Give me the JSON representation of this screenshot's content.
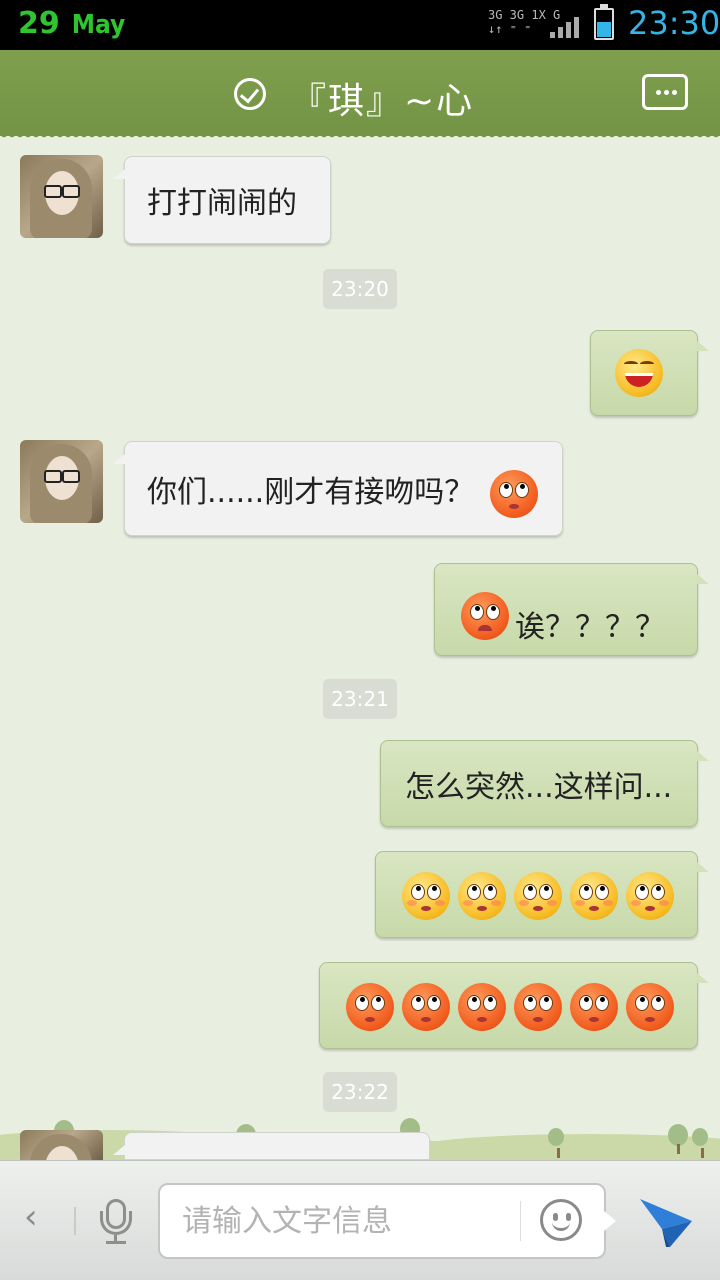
{
  "status_bar": {
    "day": "29",
    "month": "May",
    "net_top": "3G 3G 1X  G",
    "net_bottom": "↓↑ ⁼ ⁼",
    "time": "23:30",
    "battery_level": 0.55,
    "colors": {
      "date": "#2ec52e",
      "time": "#33b5e5"
    }
  },
  "header": {
    "title": "『琪』~心",
    "bg_color": "#7a9a4a"
  },
  "messages": [
    {
      "side": "in",
      "text": "打打闹闹的"
    },
    {
      "type": "time",
      "text": "23:20"
    },
    {
      "side": "out",
      "emoji": [
        "grin"
      ]
    },
    {
      "side": "in",
      "text": "你们......刚才有接吻吗？",
      "emoji": [
        "red-rolleyes"
      ]
    },
    {
      "side": "out",
      "text": "诶？？？？",
      "emoji": [
        "red-sad"
      ]
    },
    {
      "type": "time",
      "text": "23:21"
    },
    {
      "side": "out",
      "text": "怎么突然...这样问..."
    },
    {
      "side": "out",
      "emoji": [
        "yellow-rolleyes",
        "yellow-rolleyes",
        "yellow-rolleyes",
        "yellow-rolleyes",
        "yellow-rolleyes"
      ]
    },
    {
      "side": "out",
      "emoji": [
        "red-rolleyes",
        "red-rolleyes",
        "red-rolleyes",
        "red-rolleyes",
        "red-rolleyes",
        "red-rolleyes"
      ]
    },
    {
      "type": "time",
      "text": "23:22"
    }
  ],
  "input_bar": {
    "placeholder": "请输入文字信息",
    "back_icon": "chevron-left-icon",
    "voice_icon": "microphone-icon",
    "emoji_icon": "smiley-icon",
    "send_icon": "paper-plane-icon",
    "send_color": "#2f7fd8"
  }
}
